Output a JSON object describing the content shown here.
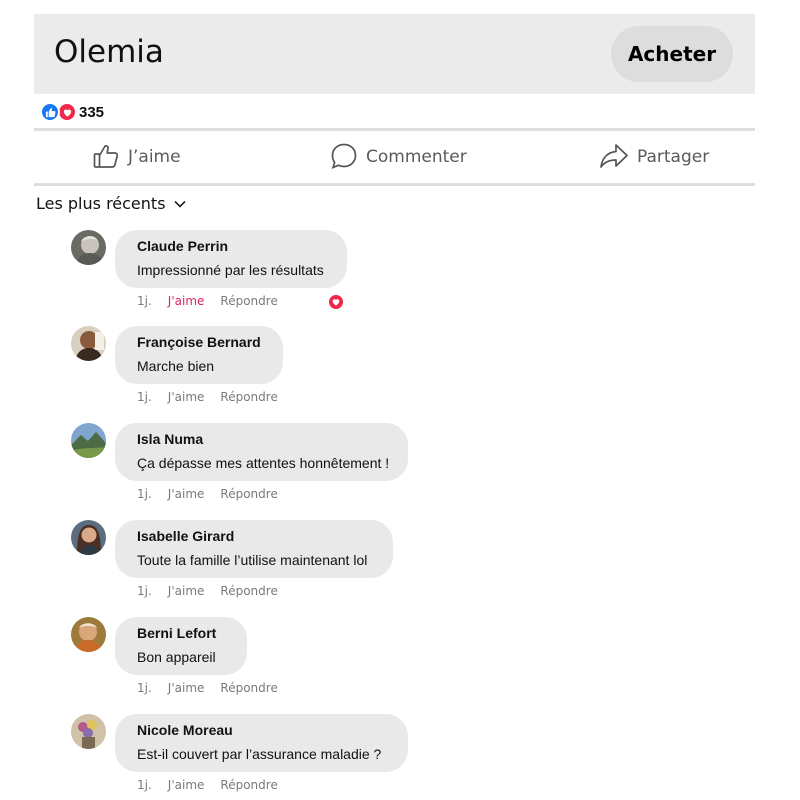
{
  "header": {
    "brand": "Olemia",
    "buy_label": "Acheter"
  },
  "reactions": {
    "count": "335"
  },
  "actions": {
    "like": "J’aime",
    "comment": "Commenter",
    "share": "Partager"
  },
  "sort": {
    "label": "Les plus récents"
  },
  "comments": [
    {
      "author": "Claude Perrin",
      "text": "Impressionné par les résultats",
      "time": "1j.",
      "like": "J'aime",
      "reply": "Répondre",
      "liked": true
    },
    {
      "author": "Françoise Bernard",
      "text": "Marche bien",
      "time": "1j.",
      "like": "J'aime",
      "reply": "Répondre"
    },
    {
      "author": "Isla Numa",
      "text": "Ça dépasse mes attentes honnêtement !",
      "time": "1j.",
      "like": "J'aime",
      "reply": "Répondre"
    },
    {
      "author": "Isabelle Girard",
      "text": "Toute la famille l’utilise maintenant lol",
      "time": "1j.",
      "like": "J'aime",
      "reply": "Répondre"
    },
    {
      "author": "Berni Lefort",
      "text": "Bon appareil",
      "time": "1j.",
      "like": "J'aime",
      "reply": "Répondre"
    },
    {
      "author": "Nicole Moreau",
      "text": "Est-il couvert par l’assurance maladie ?",
      "time": "1j.",
      "like": "J'aime",
      "reply": "Répondre"
    }
  ],
  "colors": {
    "like_blue": "#1877f2",
    "love_red": "#f0284a",
    "liked_text": "#e0245e"
  }
}
